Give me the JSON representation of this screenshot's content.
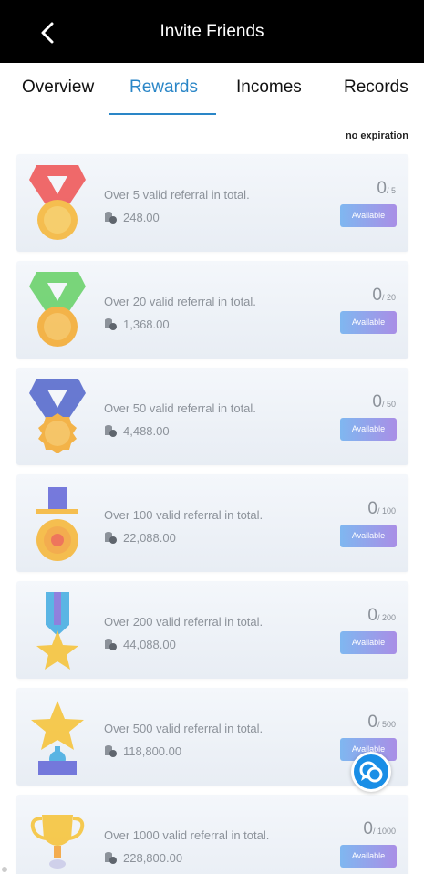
{
  "header": {
    "title": "Invite Friends",
    "back_icon": "chevron-left-icon"
  },
  "tabs": [
    {
      "label": "Overview",
      "active": false
    },
    {
      "label": "Rewards",
      "active": true
    },
    {
      "label": "Incomes",
      "active": false
    },
    {
      "label": "Records",
      "active": false
    }
  ],
  "expiry_note": "no expiration",
  "colors": {
    "accent": "#2a86c7",
    "header_bg": "#000000",
    "button_from": "#7fb7f0",
    "button_to": "#a98ee6"
  },
  "rewards": [
    {
      "icon": "red-ribbon-medal-icon",
      "description": "Over 5 valid referral in total.",
      "amount": "248.00",
      "current": "0",
      "total": "/ 5",
      "button": "Available"
    },
    {
      "icon": "green-ribbon-medal-icon",
      "description": "Over 20 valid referral in total.",
      "amount": "1,368.00",
      "current": "0",
      "total": "/ 20",
      "button": "Available"
    },
    {
      "icon": "blue-ribbon-medal-icon",
      "description": "Over 50 valid referral in total.",
      "amount": "4,488.00",
      "current": "0",
      "total": "/ 50",
      "button": "Available"
    },
    {
      "icon": "bar-medal-icon",
      "description": "Over 100 valid referral in total.",
      "amount": "22,088.00",
      "current": "0",
      "total": "/ 100",
      "button": "Available"
    },
    {
      "icon": "star-ribbon-medal-icon",
      "description": "Over 200 valid referral in total.",
      "amount": "44,088.00",
      "current": "0",
      "total": "/ 200",
      "button": "Available"
    },
    {
      "icon": "star-trophy-icon",
      "description": "Over 500 valid referral in total.",
      "amount": "118,800.00",
      "current": "0",
      "total": "/ 500",
      "button": "Available"
    },
    {
      "icon": "gold-cup-trophy-icon",
      "description": "Over 1000 valid referral in total.",
      "amount": "228,800.00",
      "current": "0",
      "total": "/ 1000",
      "button": "Available"
    }
  ],
  "chat_button": {
    "icon": "chat-bubbles-icon"
  }
}
